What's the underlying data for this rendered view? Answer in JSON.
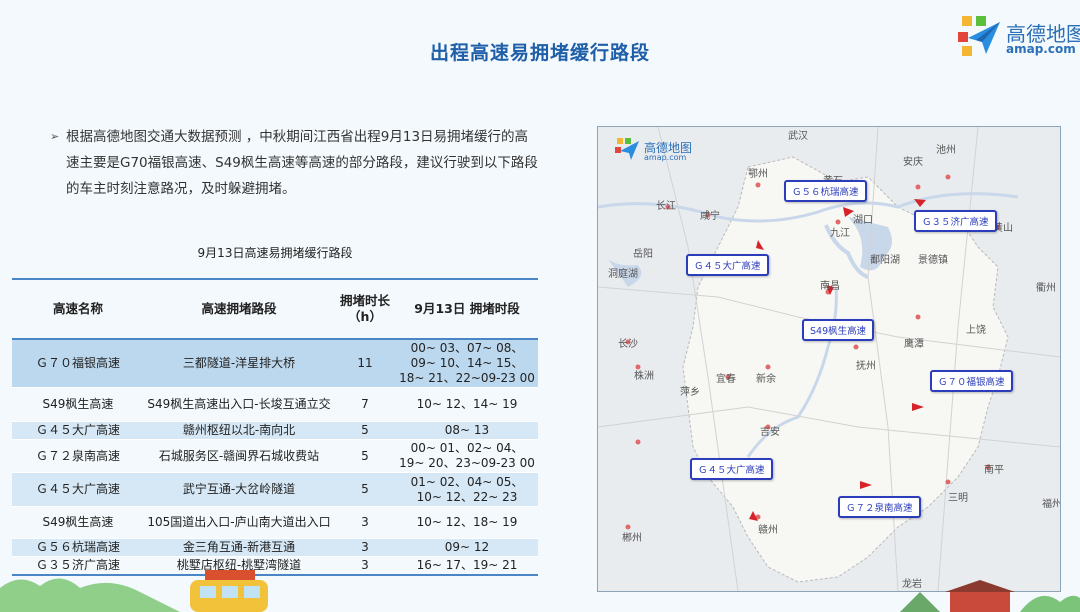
{
  "title": "出程高速易拥堵缓行路段",
  "brand": {
    "name": "高德地图",
    "domain": "amap.com",
    "icon": "amap-plane-logo-icon"
  },
  "intro": "根据高德地图交通大数据预测 ，中秋期间江西省出程9月13日易拥堵缓行的高速主要是G70福银高速、S49枫生高速等高速的部分路段，建议行驶到以下路段的车主时刻注意路况，及时躲避拥堵。",
  "table": {
    "title": "9月13日高速易拥堵缓行路段",
    "headers": [
      "高速名称",
      "高速拥堵路段",
      "拥堵时长（h）",
      "9月13日 拥堵时段"
    ],
    "rows": [
      [
        "Ｇ７０福银高速",
        "三都隧道-洋星排大桥",
        "11",
        "00~ 03、07~ 08、09~ 10、14~ 15、18~ 21、22~09-23 00"
      ],
      [
        "S49枫生高速",
        "S49枫生高速出入口-长埈互通立交",
        "7",
        "10~ 12、14~ 19"
      ],
      [
        "Ｇ４５大广高速",
        "赣州枢纽以北-南向北",
        "5",
        "08~ 13"
      ],
      [
        "Ｇ７２泉南高速",
        "石城服务区-赣闽界石城收费站",
        "5",
        "00~ 01、02~ 04、19~ 20、23~09-23 00"
      ],
      [
        "Ｇ４５大广高速",
        "武宁互通-大岔岭隧道",
        "5",
        "01~ 02、04~ 05、10~ 12、22~ 23"
      ],
      [
        "S49枫生高速",
        "105国道出入口-庐山南大道出入口",
        "3",
        "10~ 12、18~ 19"
      ],
      [
        "Ｇ５６杭瑞高速",
        "金三角互通-新港互通",
        "3",
        "09~ 12"
      ],
      [
        "Ｇ３５济广高速",
        "桃墅店枢纽-桃墅湾隧道",
        "3",
        "16~ 17、19~ 21"
      ]
    ]
  },
  "map": {
    "logo_name": "高德地图",
    "logo_domain": "amap.com",
    "cities": [
      "武汉",
      "鄂州",
      "黄石",
      "安庆",
      "池州",
      "长江",
      "咸宁",
      "九江",
      "湖口",
      "黄山",
      "岳阳",
      "洞庭湖",
      "鄱阳湖",
      "景德镇",
      "衢州",
      "南昌",
      "上饶",
      "长沙",
      "鹰潭",
      "株洲",
      "宜春",
      "新余",
      "抚州",
      "萍乡",
      "吉安",
      "南平",
      "三明",
      "福州",
      "赣州",
      "郴州",
      "龙岩"
    ],
    "road_labels": [
      "Ｇ５６杭瑞高速",
      "Ｇ３５济广高速",
      "Ｇ４５大广高速",
      "S49枫生高速",
      "Ｇ７０福银高速",
      "Ｇ４５大广高速",
      "Ｇ７２泉南高速"
    ],
    "marker_color": "#d6232a",
    "label_color": "#2b3dbb"
  }
}
